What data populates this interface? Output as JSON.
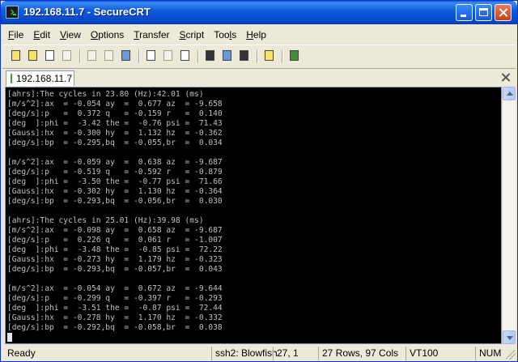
{
  "window": {
    "title": "192.168.11.7 - SecureCRT"
  },
  "menu": [
    {
      "u": "F",
      "rest": "ile"
    },
    {
      "u": "E",
      "rest": "dit"
    },
    {
      "u": "V",
      "rest": "iew"
    },
    {
      "u": "O",
      "rest": "ptions"
    },
    {
      "u": "T",
      "rest": "ransfer"
    },
    {
      "u": "S",
      "rest": "cript"
    },
    {
      "pre": "Too",
      "u": "l",
      "rest": "s"
    },
    {
      "u": "H",
      "rest": "elp"
    }
  ],
  "toolbar": {
    "icons": [
      "connect-icon",
      "quick-connect-icon",
      "connect-tab-icon",
      "reconnect-icon",
      "copy-icon",
      "paste-icon",
      "find-icon",
      "print-icon",
      "print-selection-icon",
      "print-setup-icon",
      "session-options-icon",
      "global-options-icon",
      "keymap-icon",
      "help-icon",
      "sftp-icon"
    ]
  },
  "tab": {
    "label": "192.168.11.7"
  },
  "terminal": {
    "lines": [
      "[ahrs]:The cycles in 23.80 (Hz):42.01 (ms)",
      "[m/s^2]:ax  = -0.054 ay  =  0.677 az  = -9.658",
      "[deg/s]:p   =  0.372 q   = -0.159 r   =  0.140",
      "[deg  ]:phi =  -3.42 the =  -0.76 psi =  71.43",
      "[Gauss]:hx  = -0.300 hy  =  1.132 hz  = -0.362",
      "[deg/s]:bp  = -0.295,bq  = -0.055,br  =  0.034",
      "",
      "[m/s^2]:ax  = -0.059 ay  =  0.638 az  = -9.687",
      "[deg/s]:p   = -0.519 q   = -0.592 r   = -0.879",
      "[deg  ]:phi =  -3.50 the =  -0.77 psi =  71.66",
      "[Gauss]:hx  = -0.302 hy  =  1.130 hz  = -0.364",
      "[deg/s]:bp  = -0.293,bq  = -0.056,br  =  0.030",
      "",
      "[ahrs]:The cycles in 25.01 (Hz):39.98 (ms)",
      "[m/s^2]:ax  = -0.098 ay  =  0.658 az  = -9.687",
      "[deg/s]:p   =  0.226 q   =  0.061 r   = -1.007",
      "[deg  ]:phi =  -3.48 the =  -0.85 psi =  72.22",
      "[Gauss]:hx  = -0.273 hy  =  1.179 hz  = -0.323",
      "[deg/s]:bp  = -0.293,bq  = -0.057,br  =  0.043",
      "",
      "[m/s^2]:ax  = -0.054 ay  =  0.672 az  = -9.644",
      "[deg/s]:p   = -0.299 q   = -0.397 r   = -0.293",
      "[deg  ]:phi =  -3.51 the =  -0.87 psi =  72.44",
      "[Gauss]:hx  = -0.278 hy  =  1.170 hz  = -0.332",
      "[deg/s]:bp  = -0.292,bq  = -0.058,br  =  0.038"
    ]
  },
  "status": {
    "ready": "Ready",
    "cipher": "ssh2: Blowfish",
    "position": "27,   1",
    "size": "27 Rows,  97 Cols",
    "terminal_type": "VT100",
    "num": "NUM"
  }
}
